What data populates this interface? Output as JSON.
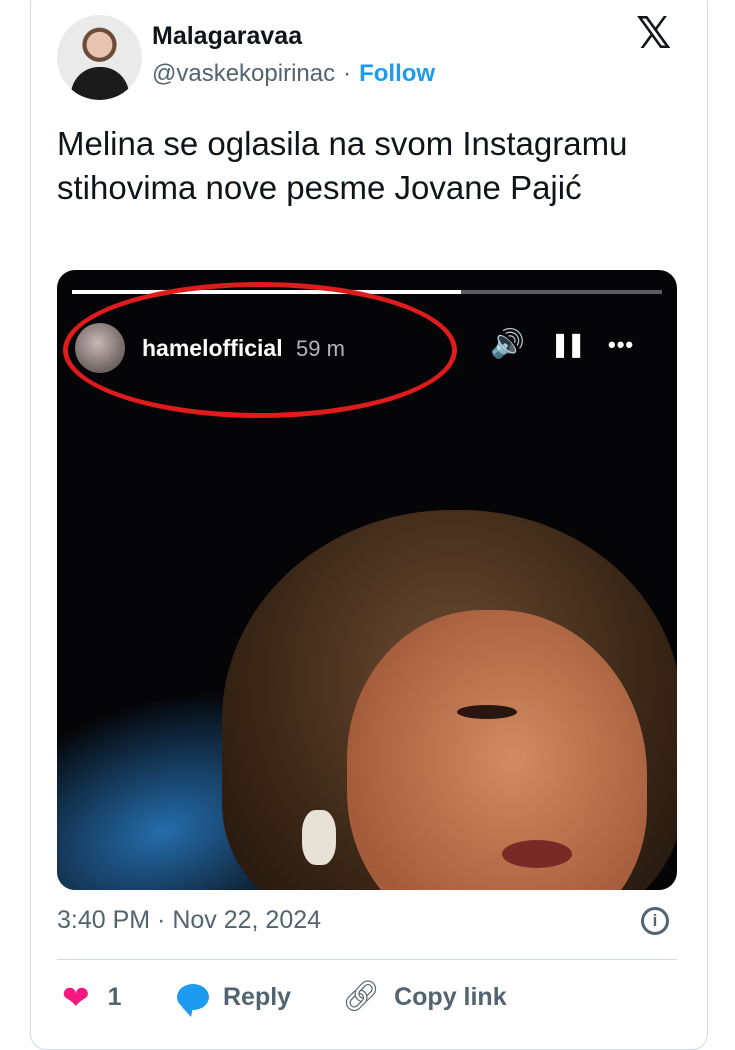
{
  "tweet": {
    "author_name": "Malagaravaa",
    "handle": "@vaskekopirinac",
    "separator": "·",
    "follow_label": "Follow",
    "platform_logo": "𝕏",
    "text": "Melina se oglasila na svom Instagramu stihovima nove pesme Jovane Pajić",
    "timestamp": "3:40 PM · Nov 22, 2024",
    "info_glyph": "i",
    "like_count": "1",
    "reply_label": "Reply",
    "copy_link_label": "Copy link"
  },
  "story": {
    "username": "hamelofficial",
    "time_ago": "59 m",
    "progress": 0.66,
    "volume_glyph": "🔊",
    "pause_glyph": "❚❚",
    "more_glyph": "•••"
  },
  "icons": {
    "heart": "heart-icon",
    "reply": "reply-bubble-icon",
    "link": "link-icon",
    "info": "info-icon",
    "x": "x-logo-icon"
  },
  "colors": {
    "follow": "#1d9bf0",
    "like": "#f91880",
    "reply_icon": "#1d9bf0",
    "text_secondary": "#536471",
    "highlight": "#e01b1b"
  }
}
